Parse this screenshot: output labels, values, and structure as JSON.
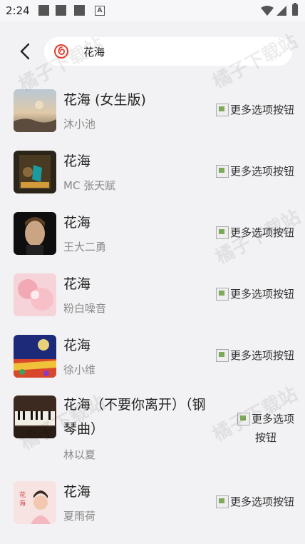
{
  "status_bar": {
    "time": "2:24"
  },
  "search": {
    "query": "花海"
  },
  "results": [
    {
      "title": "花海 (女生版)",
      "artist": "沐小池",
      "more_alt": "更多选项按钮"
    },
    {
      "title": "花海",
      "artist": "MC 张天赋",
      "more_alt": "更多选项按钮"
    },
    {
      "title": "花海",
      "artist": "王大二勇",
      "more_alt": "更多选项按钮"
    },
    {
      "title": "花海",
      "artist": "粉白噪音",
      "more_alt": "更多选项按钮"
    },
    {
      "title": "花海",
      "artist": "徐小维",
      "more_alt": "更多选项按钮"
    },
    {
      "title_line1": "花海（不要你离开）（钢",
      "title_line2": "琴曲）",
      "artist": "林以夏",
      "more_alt_line1": "更多选项",
      "more_alt_line2": "按钮"
    },
    {
      "title": "花海",
      "artist": "夏雨荷",
      "more_alt": "更多选项按钮"
    }
  ],
  "watermark": "橘子下载站",
  "colors": {
    "background": "#f2f2f4",
    "accent": "#e63b2e"
  }
}
